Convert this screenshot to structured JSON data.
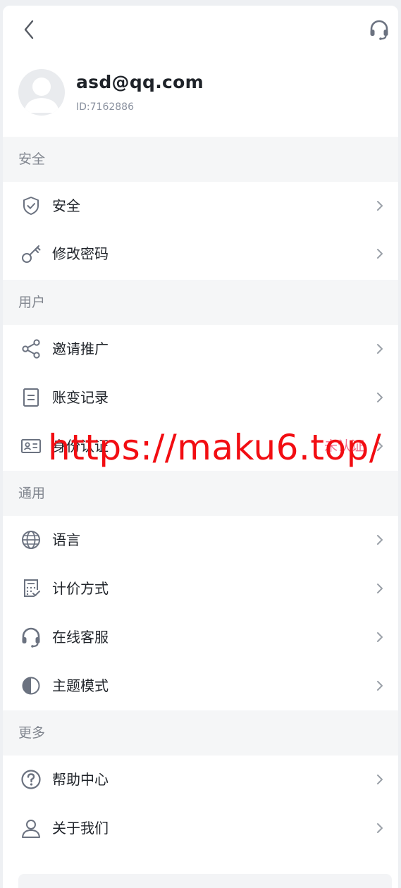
{
  "header": {
    "back_icon": "chevron-left-icon",
    "support_icon": "headset-icon"
  },
  "profile": {
    "email": "asd@qq.com",
    "uid": "ID:7162886",
    "avatar_icon": "default-avatar-icon"
  },
  "sections": {
    "security": {
      "title": "安全",
      "items": [
        {
          "label": "安全",
          "icon": "shield-check-icon"
        },
        {
          "label": "修改密码",
          "icon": "key-icon"
        }
      ]
    },
    "user": {
      "title": "用户",
      "items": [
        {
          "label": "邀请推广",
          "icon": "share-icon"
        },
        {
          "label": "账变记录",
          "icon": "document-icon"
        },
        {
          "label": "身份认证",
          "icon": "id-card-icon",
          "status": "未认证"
        }
      ]
    },
    "general": {
      "title": "通用",
      "items": [
        {
          "label": "语言",
          "icon": "globe-icon"
        },
        {
          "label": "计价方式",
          "icon": "calculator-icon"
        },
        {
          "label": "在线客服",
          "icon": "headset-icon"
        },
        {
          "label": "主题模式",
          "icon": "half-circle-icon"
        }
      ]
    },
    "more": {
      "title": "更多",
      "items": [
        {
          "label": "帮助中心",
          "icon": "question-circle-icon"
        },
        {
          "label": "关于我们",
          "icon": "user-icon"
        }
      ]
    }
  },
  "watermark": {
    "text": "https://maku6.top/"
  },
  "colors": {
    "accent_status": "#f26d8c",
    "watermark": "#f20d12",
    "icon": "#6b7280"
  }
}
